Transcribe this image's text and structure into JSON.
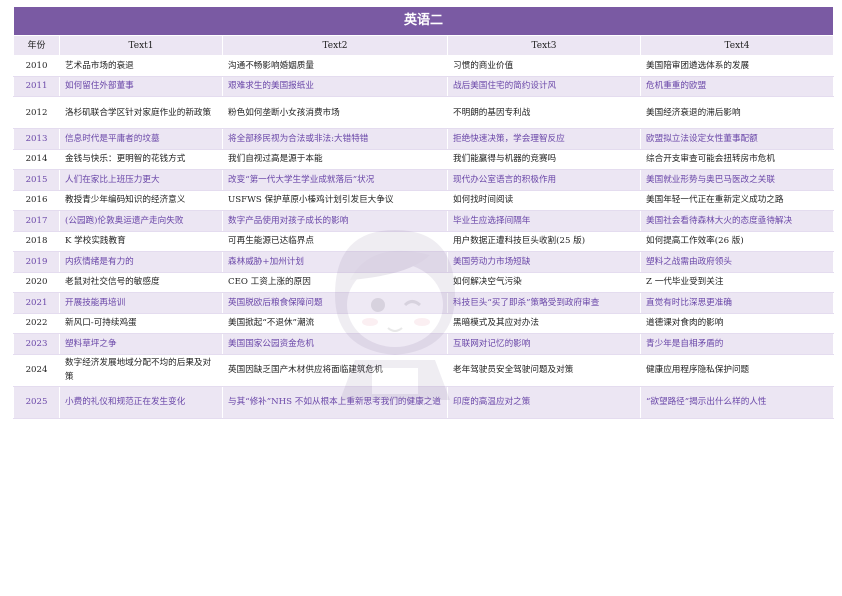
{
  "table": {
    "title": "英语二",
    "headers": [
      "年份",
      "Text1",
      "Text2",
      "Text3",
      "Text4"
    ],
    "rows": [
      {
        "year": "2010",
        "t1": "艺术品市场的衰退",
        "t2": "沟通不畅影响婚姻质量",
        "t3": "习惯的商业价值",
        "t4": "美国陪审团遴选体系的发展"
      },
      {
        "year": "2011",
        "t1": "如何留住外部董事",
        "t2": "艰难求生的美国报纸业",
        "t3": "战后美国住宅的简约设计风",
        "t4": "危机重重的欧盟"
      },
      {
        "year": "2012",
        "t1": "洛杉矶联合学区针对家庭作业的新政策",
        "t2": "粉色如何垄断小女孩消费市场",
        "t3": "不明朗的基因专利战",
        "t4": "美国经济衰退的滞后影响"
      },
      {
        "year": "2013",
        "t1": "信息时代是平庸者的坟墓",
        "t2": "将全部移民视为合法或非法:大错特错",
        "t3": "拒绝快速决策，学会理智反应",
        "t4": "欧盟拟立法设定女性董事配额"
      },
      {
        "year": "2014",
        "t1": "金钱与快乐：更明智的花钱方式",
        "t2": "我们自视过高是源于本能",
        "t3": "我们能赢得与机器的竞赛吗",
        "t4": "综合开支审查可能会扭转房市危机"
      },
      {
        "year": "2015",
        "t1": "人们在家比上班压力更大",
        "t2": "改变“第一代大学生学业成就落后”状况",
        "t3": "现代办公室语言的积极作用",
        "t4": "美国就业形势与奥巴马医改之关联"
      },
      {
        "year": "2016",
        "t1": "教授青少年编码知识的经济意义",
        "t2": "USFWS 保护草原小榛鸡计划引发巨大争议",
        "t3": "如何找时间阅读",
        "t4": "美国年轻一代正在重新定义成功之路"
      },
      {
        "year": "2017",
        "t1": "(公园跑)伦敦奥运遗产走向失败",
        "t2": "数字产品使用对孩子成长的影响",
        "t3": "毕业生应选择间隔年",
        "t4": "美国社会看待森林大火的态度亟待解决"
      },
      {
        "year": "2018",
        "t1": "K 学校实践教育",
        "t2": "可再生能源已达临界点",
        "t3": "用户数据正遭科技巨头收割(25 版)",
        "t4": "如何提高工作效率(26 版)"
      },
      {
        "year": "2019",
        "t1": "内疚情绪是有力的",
        "t2": "森林威胁+加州计划",
        "t3": "美国劳动力市场短缺",
        "t4": "塑料之战需由政府领头"
      },
      {
        "year": "2020",
        "t1": "老鼠对社交信号的敏感度",
        "t2": "CEO 工资上涨的原因",
        "t3": "如何解决空气污染",
        "t4": "Z 一代毕业受到关注"
      },
      {
        "year": "2021",
        "t1": "开展技能再培训",
        "t2": "英国脱欧后粮食保障问题",
        "t3": "科技巨头“买了即杀”策略受到政府审查",
        "t4": "直觉有时比深思更准确"
      },
      {
        "year": "2022",
        "t1": "新风口-可持续鸡蛋",
        "t2": "美国掀起“不退休”潮流",
        "t3": "黑暗模式及其应对办法",
        "t4": "道德课对食肉的影响"
      },
      {
        "year": "2023",
        "t1": "塑料草坪之争",
        "t2": "美国国家公园资金危机",
        "t3": "互联网对记忆的影响",
        "t4": "青少年是自相矛盾的"
      },
      {
        "year": "2024",
        "t1": "数字经济发展地域分配不均的后果及对策",
        "t2": "英国因缺乏国产木材供应将面临建筑危机",
        "t3": "老年驾驶员安全驾驶问题及对策",
        "t4": "健康应用程序隐私保护问题"
      },
      {
        "year": "2025",
        "t1": "小费的礼仪和规范正在发生变化",
        "t2": "与其“修补”NHS 不如从根本上重新思考我们的健康之道",
        "t3": "印度的高温应对之策",
        "t4": "“欲望路径”揭示出什么样的人性"
      }
    ]
  },
  "colors": {
    "title_bg": "#7a5aa3",
    "header_bg": "#ece6f3",
    "alt_row_bg": "#ece6f3",
    "alt_row_text": "#6a47a8",
    "row_text": "#1f1f1f"
  },
  "watermark": {
    "icon": "cartoon-avatar-watermark-icon"
  }
}
